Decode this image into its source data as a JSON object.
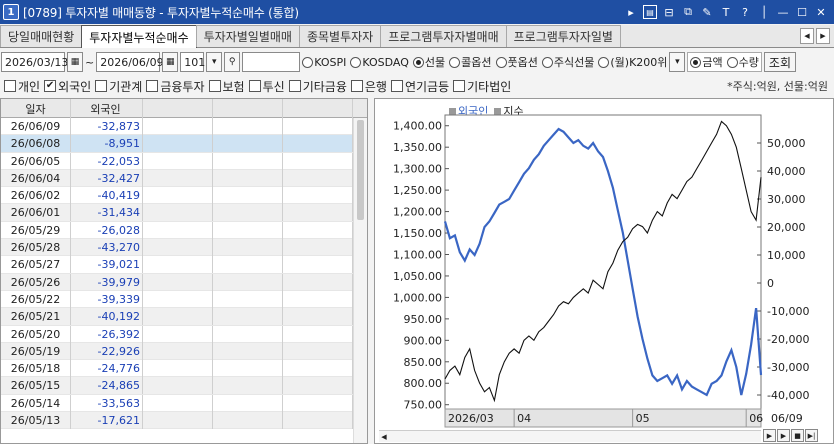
{
  "window": {
    "num": "1",
    "title": "[0789] 투자자별 매매동향 - 투자자별누적순매수 (통합)",
    "icons": [
      "play-icon",
      "layout-icon",
      "split-icon",
      "copy-icon",
      "pin-icon",
      "font-icon",
      "help-icon",
      "minimize-icon",
      "maximize-icon",
      "close-icon"
    ]
  },
  "tabs": [
    "당일매매현황",
    "투자자별누적순매수",
    "투자자별일별매매",
    "종목별투자자",
    "프로그램투자자별매매",
    "프로그램투자자일별"
  ],
  "active_tab": 1,
  "query": {
    "start_date": "2026/03/13",
    "end_date": "2026/06/09",
    "count": "101",
    "search_value": "",
    "market_options": [
      "KOSPI",
      "KOSDAQ",
      "선물",
      "콜옵션",
      "풋옵션",
      "주식선물",
      "(월)K200위"
    ],
    "market_selected": 2,
    "measure_options": [
      "금액",
      "수량"
    ],
    "measure_selected": 0,
    "query_button": "조회"
  },
  "investors": [
    {
      "label": "개인",
      "checked": false
    },
    {
      "label": "외국인",
      "checked": true
    },
    {
      "label": "기관계",
      "checked": false
    },
    {
      "label": "금융투자",
      "checked": false
    },
    {
      "label": "보험",
      "checked": false
    },
    {
      "label": "투신",
      "checked": false
    },
    {
      "label": "기타금융",
      "checked": false
    },
    {
      "label": "은행",
      "checked": false
    },
    {
      "label": "연기금등",
      "checked": false
    },
    {
      "label": "기타법인",
      "checked": false
    }
  ],
  "unit_note": "*주식:억원, 선물:억원",
  "grid": {
    "headers": [
      "일자",
      "외국인"
    ],
    "selected_row": 1,
    "rows": [
      [
        "26/06/09",
        "-32,873"
      ],
      [
        "26/06/08",
        "-8,951"
      ],
      [
        "26/06/05",
        "-22,053"
      ],
      [
        "26/06/04",
        "-32,427"
      ],
      [
        "26/06/02",
        "-40,419"
      ],
      [
        "26/06/01",
        "-31,434"
      ],
      [
        "26/05/29",
        "-26,028"
      ],
      [
        "26/05/28",
        "-43,270"
      ],
      [
        "26/05/27",
        "-39,021"
      ],
      [
        "26/05/26",
        "-39,979"
      ],
      [
        "26/05/22",
        "-39,339"
      ],
      [
        "26/05/21",
        "-40,192"
      ],
      [
        "26/05/20",
        "-26,392"
      ],
      [
        "26/05/19",
        "-22,926"
      ],
      [
        "26/05/18",
        "-24,776"
      ],
      [
        "26/05/15",
        "-24,865"
      ],
      [
        "26/05/14",
        "-33,563"
      ],
      [
        "26/05/13",
        "-17,621"
      ]
    ]
  },
  "chart_data": {
    "type": "line",
    "legend": [
      "외국인",
      "지수"
    ],
    "left_axis": {
      "series": "지수",
      "range": [
        740,
        1425
      ],
      "ticks": [
        750,
        800,
        850,
        900,
        950,
        1000,
        1050,
        1100,
        1150,
        1200,
        1250,
        1300,
        1350,
        1400
      ],
      "tick_labels": [
        "750.00",
        "800.00",
        "850.00",
        "900.00",
        "950.00",
        "1,000.00",
        "1,050.00",
        "1,100.00",
        "1,150.00",
        "1,200.00",
        "1,250.00",
        "1,300.00",
        "1,350.00",
        "1,400.00"
      ]
    },
    "right_axis": {
      "series": "외국인",
      "range": [
        -45000,
        60000
      ],
      "ticks": [
        -40000,
        -30000,
        -20000,
        -10000,
        0,
        10000,
        20000,
        30000,
        40000,
        50000
      ],
      "tick_labels": [
        "-40,000",
        "-30,000",
        "-20,000",
        "-10,000",
        "0",
        "10,000",
        "20,000",
        "30,000",
        "40,000",
        "50,000"
      ]
    },
    "x_labels": [
      {
        "label": "2026/03",
        "index": 0
      },
      {
        "label": "04",
        "index": 14
      },
      {
        "label": "05",
        "index": 38
      },
      {
        "label": "06",
        "index": 61
      }
    ],
    "last_label": "06/09",
    "series": [
      {
        "name": "외국인",
        "color": "#3a66c4",
        "values": [
          22000,
          16000,
          17000,
          11000,
          8000,
          12000,
          10000,
          14000,
          20000,
          22000,
          25000,
          28000,
          29000,
          30000,
          33000,
          36000,
          39000,
          41000,
          44000,
          46000,
          49000,
          51000,
          53000,
          55000,
          54000,
          52000,
          50000,
          51000,
          49000,
          48000,
          50000,
          47000,
          45000,
          40000,
          34000,
          26000,
          18000,
          8000,
          -2000,
          -12000,
          -20000,
          -27000,
          -33000,
          -35000,
          -34000,
          -33000,
          -36000,
          -33000,
          -38000,
          -35000,
          -37000,
          -38000,
          -39000,
          -40000,
          -36000,
          -35000,
          -33000,
          -28000,
          -24000,
          -30000,
          -40000,
          -32427,
          -22053,
          -8951,
          -32873
        ]
      },
      {
        "name": "지수",
        "color": "#111111",
        "values": [
          810,
          830,
          840,
          820,
          860,
          880,
          830,
          800,
          780,
          790,
          760,
          820,
          850,
          870,
          880,
          870,
          900,
          910,
          900,
          920,
          930,
          945,
          960,
          980,
          990,
          985,
          1000,
          1010,
          1020,
          1010,
          1040,
          1030,
          1020,
          1060,
          1080,
          1110,
          1130,
          1140,
          1160,
          1170,
          1165,
          1150,
          1180,
          1200,
          1190,
          1220,
          1240,
          1230,
          1250,
          1270,
          1280,
          1300,
          1320,
          1340,
          1360,
          1380,
          1410,
          1400,
          1380,
          1350,
          1300,
          1250,
          1200,
          1180,
          1280
        ]
      }
    ]
  },
  "chart_nav": [
    "scroll-left-icon",
    "scroll-right-icon",
    "play-icon",
    "stop-icon",
    "next-icon"
  ]
}
